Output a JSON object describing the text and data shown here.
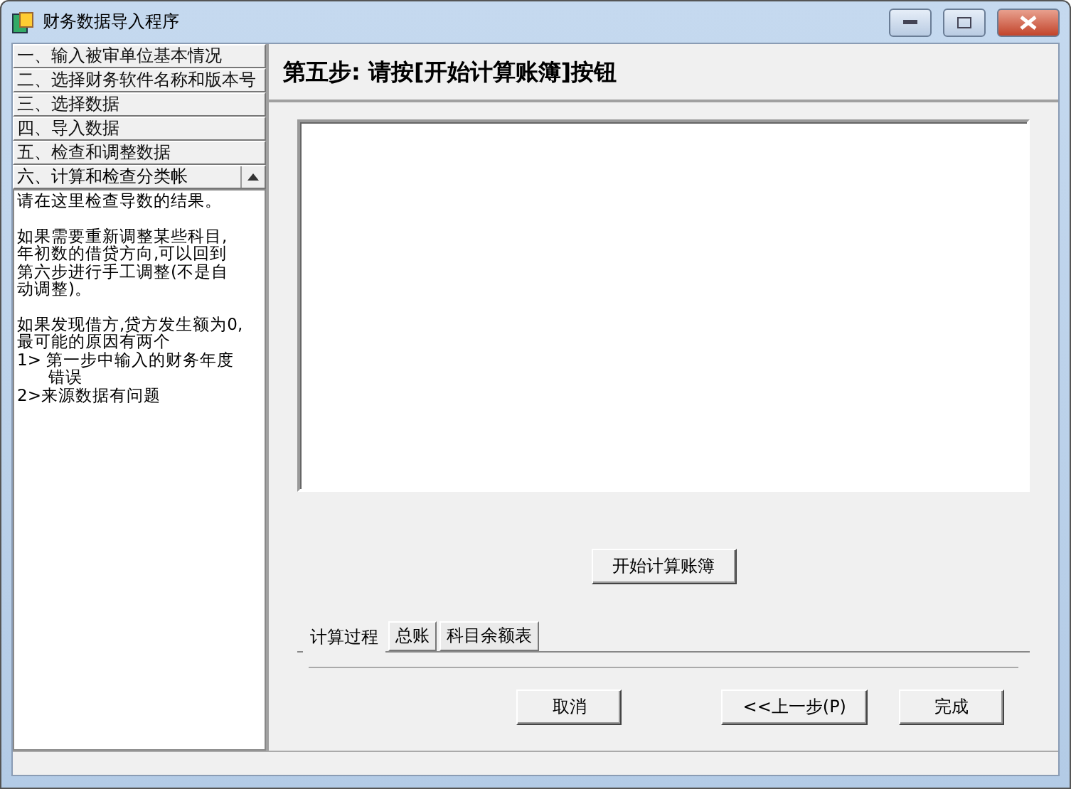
{
  "window": {
    "title": "财务数据导入程序"
  },
  "steps": [
    {
      "label": "一、输入被审单位基本情况",
      "selected": false
    },
    {
      "label": "二、选择财务软件名称和版本号",
      "selected": false
    },
    {
      "label": "三、选择数据",
      "selected": false
    },
    {
      "label": "四、导入数据",
      "selected": false
    },
    {
      "label": "五、检查和调整数据",
      "selected": false
    },
    {
      "label": "六、计算和检查分类帐",
      "selected": true
    }
  ],
  "notes": [
    [
      "请在这里检查导数的结果。"
    ],
    [
      "如果需要重新调整某些科目,",
      "年初数的借贷方向,可以回到",
      "第六步进行手工调整(不是自",
      "动调整)。"
    ],
    [
      "如果发现借方,贷方发生额为0,",
      "最可能的原因有两个",
      "1> 第一步中输入的财务年度",
      "      错误",
      "2>来源数据有问题"
    ]
  ],
  "heading": "第五步: 请按[开始计算账簿]按钮",
  "action_button": "开始计算账簿",
  "tabs": [
    {
      "label": "计算过程",
      "selected": true
    },
    {
      "label": "总账",
      "selected": false
    },
    {
      "label": "科目余额表",
      "selected": false
    }
  ],
  "buttons": [
    "取消",
    "<<上一步(P)",
    "完成"
  ]
}
